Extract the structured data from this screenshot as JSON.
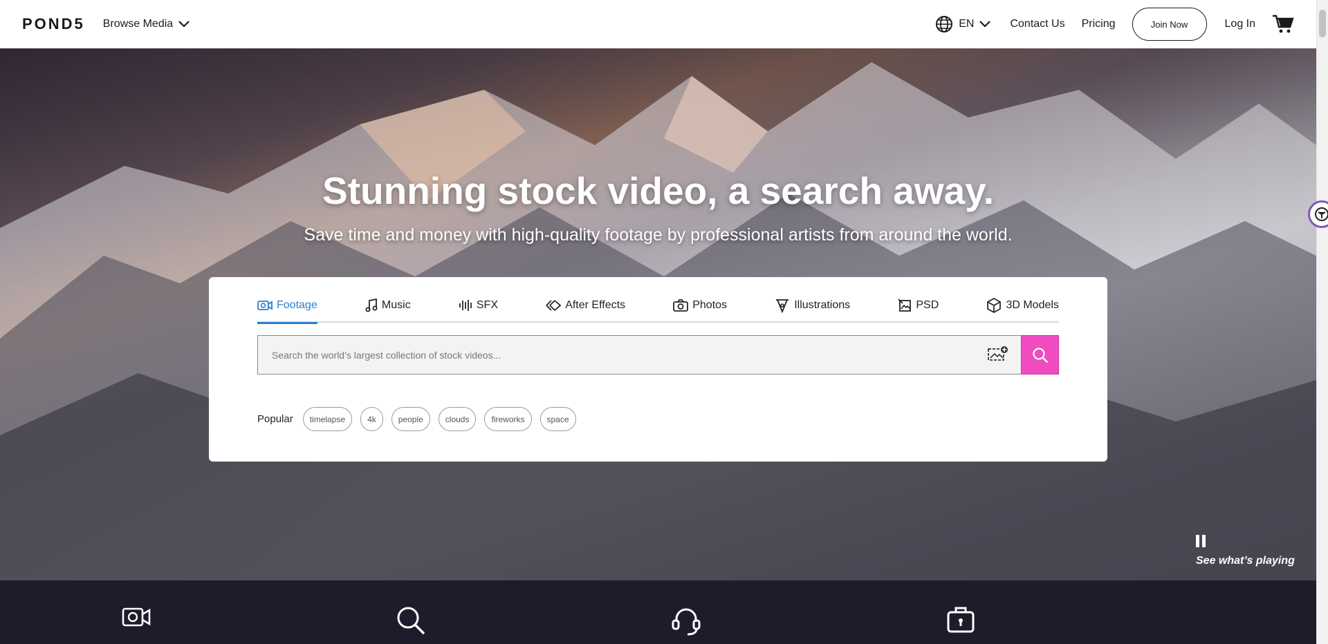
{
  "nav": {
    "logo": "POND5",
    "browse": "Browse Media",
    "lang": "EN",
    "contact": "Contact Us",
    "pricing": "Pricing",
    "join": "Join Now",
    "login": "Log In"
  },
  "hero": {
    "title": "Stunning stock video, a search away.",
    "subtitle": "Save time and money with high-quality footage by professional artists from around the world.",
    "see_playing": "See what’s playing"
  },
  "search": {
    "placeholder": "Search the world’s largest collection of stock videos...",
    "tabs": [
      {
        "label": "Footage",
        "icon": "video-camera-icon",
        "active": true
      },
      {
        "label": "Music",
        "icon": "music-note-icon",
        "active": false
      },
      {
        "label": "SFX",
        "icon": "sound-wave-icon",
        "active": false
      },
      {
        "label": "After Effects",
        "icon": "after-effects-icon",
        "active": false
      },
      {
        "label": "Photos",
        "icon": "camera-icon",
        "active": false
      },
      {
        "label": "Illustrations",
        "icon": "pen-nib-icon",
        "active": false
      },
      {
        "label": "PSD",
        "icon": "psd-icon",
        "active": false
      },
      {
        "label": "3D Models",
        "icon": "cube-icon",
        "active": false
      }
    ],
    "popular_label": "Popular",
    "popular_tags": [
      "timelapse",
      "4k",
      "people",
      "clouds",
      "fireworks",
      "space"
    ]
  },
  "features": [
    {
      "icon": "video-camera-icon"
    },
    {
      "icon": "search-icon"
    },
    {
      "icon": "support-headset-icon"
    },
    {
      "icon": "license-bag-icon"
    }
  ],
  "colors": {
    "accent_blue": "#2a7fcf",
    "search_button": "#f04cc0",
    "band": "#1f1b2b"
  }
}
